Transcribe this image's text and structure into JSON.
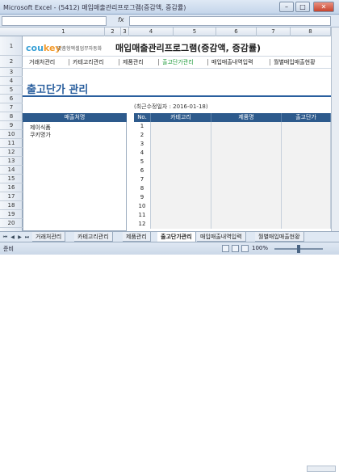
{
  "window": {
    "title": "Microsoft Excel - (5412) 매입매출관리프로그램(증감액, 증감률)",
    "btn_min": "–",
    "btn_max": "□",
    "btn_close": "✕"
  },
  "formula_bar": {
    "fx": "fx"
  },
  "columns": [
    "1",
    "2",
    "3",
    "4",
    "5",
    "6",
    "7",
    "8"
  ],
  "rows": [
    "1",
    "2",
    "3",
    "4",
    "5",
    "6",
    "7",
    "8",
    "9",
    "10",
    "11",
    "12",
    "13",
    "14",
    "15",
    "16",
    "17",
    "18",
    "19",
    "20"
  ],
  "header": {
    "logo_main": "cou",
    "logo_accent": "key",
    "logo_sub": "맞춤형엑셀업무자동화",
    "app_title": "매입매출관리프로그램(증감액, 증감률)"
  },
  "nav": [
    {
      "label": "거래처관리"
    },
    {
      "label": "카테고리관리"
    },
    {
      "label": "제품관리"
    },
    {
      "label": "출고단가관리"
    },
    {
      "label": "매입매출내역입력"
    },
    {
      "label": "월별매입매출현황"
    }
  ],
  "page": {
    "title": "출고단가 관리",
    "revision": "(최근수정일자 : 2016-01-18)"
  },
  "customer_panel": {
    "header": "매출처명",
    "items": [
      "제이식품",
      "쿠키명가"
    ]
  },
  "table": {
    "headers": [
      "No.",
      "카테고리",
      "제품명",
      "출고단가"
    ],
    "rows": [
      "1",
      "2",
      "3",
      "4",
      "5",
      "6",
      "7",
      "8",
      "9",
      "10",
      "11",
      "12"
    ]
  },
  "sheet_tabs": [
    "거래처관리",
    "카테고리관리",
    "제품관리",
    "출고단가관리",
    "매입매출내역입력",
    "월별매입매출현황"
  ],
  "active_tab": "출고단가관리",
  "status": {
    "text": "준비",
    "zoom": "100%"
  }
}
